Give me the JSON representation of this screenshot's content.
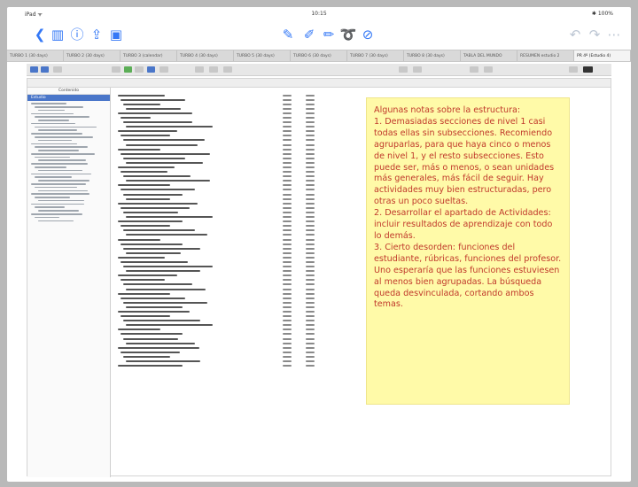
{
  "status_bar": {
    "left": "iPad ᯤ",
    "time": "10:15",
    "right": "✱ 100%"
  },
  "toolbar": {
    "icons": [
      {
        "name": "back-chevron-icon",
        "glyph": "❮"
      },
      {
        "name": "sidebar-toggle-icon",
        "glyph": "▥"
      },
      {
        "name": "info-icon",
        "glyph": "ⓘ"
      },
      {
        "name": "share-icon",
        "glyph": "⇪"
      },
      {
        "name": "page-thumbnail-icon",
        "glyph": "▣"
      }
    ],
    "tools": [
      {
        "name": "pen-tool-icon",
        "glyph": "✎"
      },
      {
        "name": "highlighter-tool-icon",
        "glyph": "✐"
      },
      {
        "name": "pencil-tool-icon",
        "glyph": "✏"
      },
      {
        "name": "lasso-tool-icon",
        "glyph": "➰"
      },
      {
        "name": "eraser-tool-icon",
        "glyph": "⊘"
      }
    ],
    "right_icons": [
      {
        "name": "undo-icon",
        "glyph": "↶"
      },
      {
        "name": "redo-icon",
        "glyph": "↷"
      },
      {
        "name": "more-icon",
        "glyph": "⋯"
      }
    ]
  },
  "tabs": [
    "TURBO 1 (30 days)",
    "TURBO 2 (30 days)",
    "TURBO 3 (calendar)",
    "TURBO 4 (30 days)",
    "TURBO 5 (30 days)",
    "TURBO 6 (30 days)",
    "TURBO 7 (30 days)",
    "TURBO 8 (30 days)",
    "TABLA DEL MUNDO",
    "RESUMEN estudio 2",
    "PR 4º (Estudio 4)"
  ],
  "active_tab_index": 10,
  "sidebar": {
    "title": "Contenido",
    "active_item": "Estudio"
  },
  "note": {
    "text": "Algunas notas sobre la estructura:\n1. Demasiadas secciones de nivel 1 casi todas ellas sin subsecciones. Recomiendo agruparlas, para que haya cinco o menos de nivel 1, y el resto subsecciones. Esto puede ser, más o menos, o sean unidades más generales, más fácil de seguir. Hay actividades muy bien estructuradas, pero otras un poco sueltas.\n2. Desarrollar el apartado de Actividades: incluir resultados de aprendizaje con todo lo demás.\n3. Cierto desorden: funciones del estudiante, rúbricas, funciones del profesor. Uno esperaría que las funciones estuviesen al menos bien agrupadas. La búsqueda queda desvinculada, cortando ambos temas."
  },
  "colors": {
    "accent": "#3478f6",
    "note_background": "#fffaa8",
    "note_text": "#c0392b",
    "selection": "#4a76c9"
  }
}
